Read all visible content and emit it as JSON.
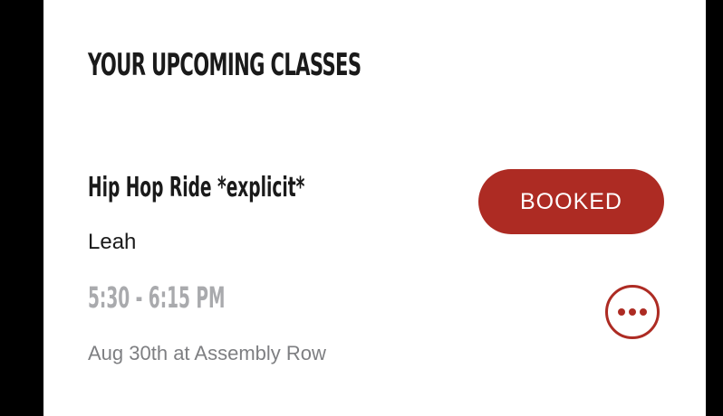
{
  "section": {
    "title": "YOUR UPCOMING CLASSES"
  },
  "class": {
    "name": "Hip Hop Ride *explicit*",
    "instructor": "Leah",
    "time": "5:30 - 6:15 PM",
    "date_location": "Aug 30th at Assembly Row",
    "status_label": "BOOKED",
    "more_icon": "more-options-icon"
  },
  "colors": {
    "accent": "#ad2b23",
    "text": "#1a1a1a",
    "time_gray": "#a9aaad",
    "date_gray": "#7e7f82"
  }
}
